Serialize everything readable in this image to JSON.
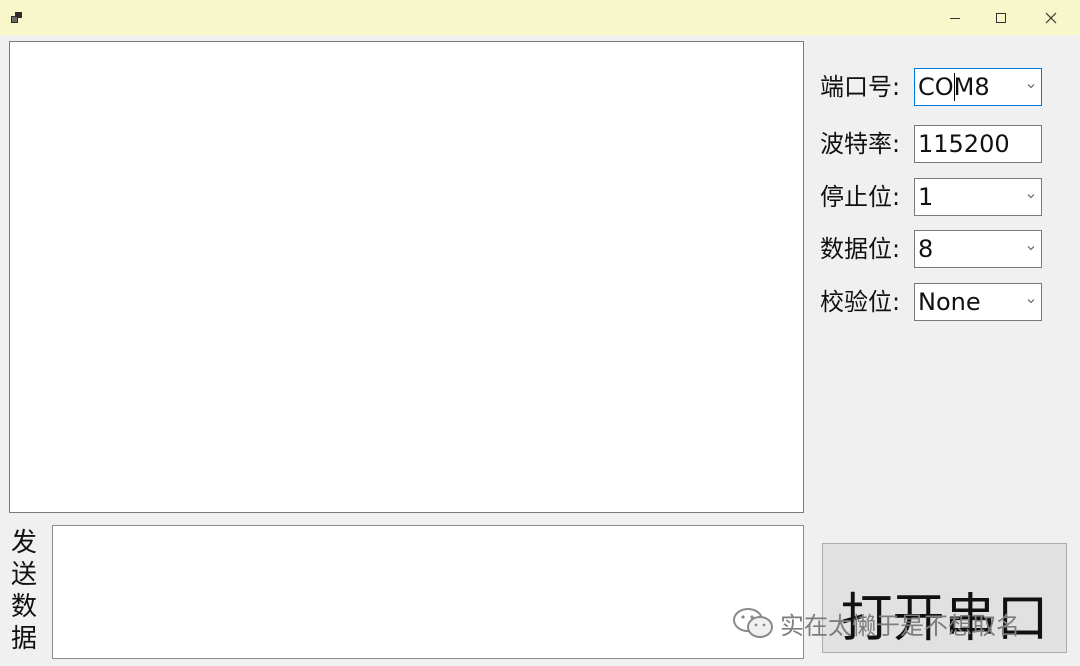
{
  "window": {
    "icon": "app-icon",
    "controls": [
      "minimize-icon",
      "maximize-icon",
      "close-icon"
    ]
  },
  "fields": [
    {
      "label": "端口号:",
      "value": "COM8",
      "type": "combo"
    },
    {
      "label": "波特率:",
      "value": "115200",
      "type": "textbox"
    },
    {
      "label": "停止位:",
      "value": "1",
      "type": "combo"
    },
    {
      "label": "数据位:",
      "value": "8",
      "type": "combo"
    },
    {
      "label": "校验位:",
      "value": "None",
      "type": "combo"
    }
  ],
  "send": {
    "label_chars": [
      "发",
      "送",
      "数",
      "据"
    ]
  },
  "open_button_label": "打开串口",
  "watermark_text": "实在太懒于是不想取名",
  "colors": {
    "titlebar": "#f7f7c9",
    "focus_border": "#0078d7"
  }
}
